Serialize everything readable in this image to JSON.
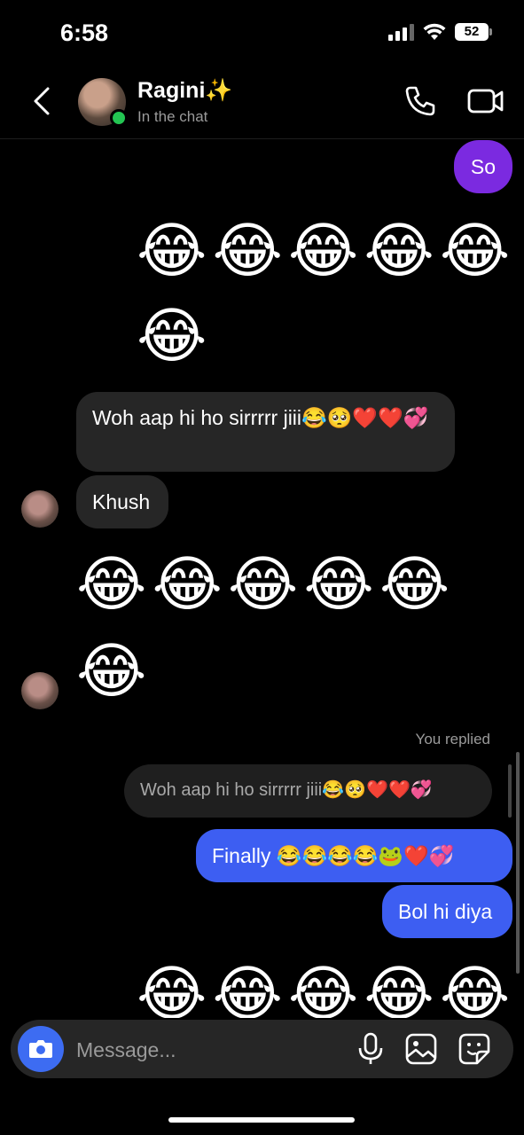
{
  "status_bar": {
    "time": "6:58",
    "battery": "52"
  },
  "header": {
    "contact_name": "Ragini✨",
    "status": "In the chat"
  },
  "messages": {
    "sent_so": "So",
    "laugh_row_1": "😂😂😂😂😂",
    "laugh_row_2": "😂",
    "received_1": "Woh aap hi ho sirrrrr jiii😂🥺❤️❤️💞",
    "received_2": "Khush",
    "laugh_row_3": "😂😂😂😂😂",
    "laugh_row_4": "😂",
    "replied_label": "You replied",
    "reply_quote": "Woh aap hi ho sirrrrr jiii😂🥺❤️❤️💞",
    "sent_finally": "Finally 😂😂😂😂🐸❤️💞",
    "sent_bol": "Bol hi diya",
    "laugh_row_5": "😂😂😂😂😂"
  },
  "composer": {
    "placeholder": "Message..."
  },
  "colors": {
    "background": "#000000",
    "incoming_bubble": "#262626",
    "outgoing_purple": "#7b2ae0",
    "outgoing_blue": "#3d5ef2",
    "online_dot": "#23c552"
  }
}
